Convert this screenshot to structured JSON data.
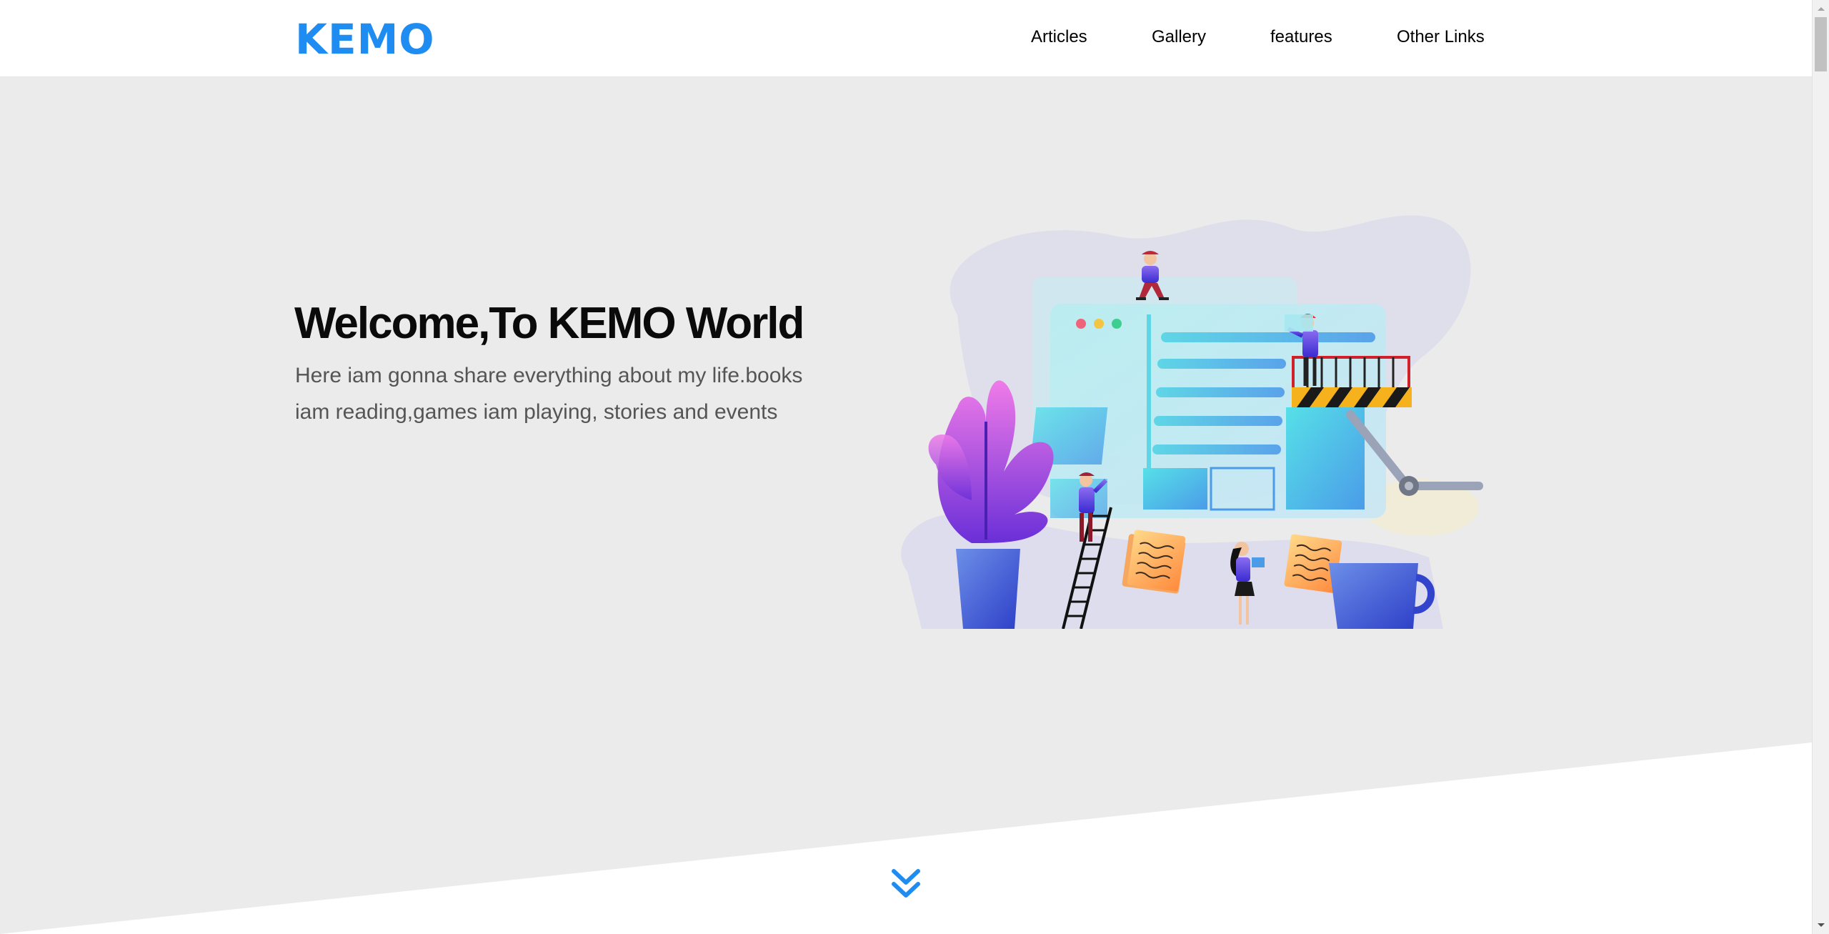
{
  "logo": "KEMO",
  "nav": {
    "items": [
      {
        "label": "Articles"
      },
      {
        "label": "Gallery"
      },
      {
        "label": "features"
      },
      {
        "label": "Other Links"
      }
    ]
  },
  "hero": {
    "title": "Welcome,To KEMO World",
    "text": "Here iam gonna share everything about my life.books iam reading,games iam playing, stories and events"
  },
  "icons": {
    "scroll": "double-chevron-down-icon"
  },
  "colors": {
    "accent": "#1e8cf0",
    "background": "#ebebeb",
    "header": "#ffffff"
  }
}
